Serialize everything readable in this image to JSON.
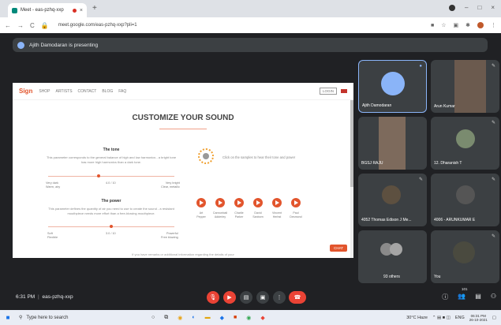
{
  "browser": {
    "tab_title": "Meet - eas-pzhq-xxp",
    "tab_close": "×",
    "new_tab": "+",
    "url": "meet.google.com/eas-pzhq-xxp?pli=1",
    "window_controls": [
      "–",
      "□",
      "×"
    ]
  },
  "presenting_banner": "Ajith Damodaran is presenting",
  "shared_site": {
    "logo": "Sign",
    "nav": [
      "SHOP",
      "ARTISTS",
      "CONTACT",
      "BLOG",
      "FAQ"
    ],
    "login": "LOGIN",
    "title": "CUSTOMIZE YOUR SOUND",
    "tone": {
      "title": "The tone",
      "text": "This parameter corresponds to the general balance of high and low harmonics - a bright tone has more high harmonics than a dark tone.",
      "left_label": "Very dark\nWarm, airy",
      "mid_label": "4.0 / 10",
      "right_label": "Very bright\nClear, metallic",
      "value": 0.4
    },
    "power": {
      "title": "The power",
      "text": "This parameter defines the quantity of air you need to use to create the sound - a resistant mouthpiece needs more effort than a free-blowing mouthpiece.",
      "left_label": "Soft\nFlexible",
      "mid_label": "3.0 / 10",
      "right_label": "Powerful\nFree blowing",
      "value": 0.5
    },
    "click_text": "Click on the samples to hear their tone and power",
    "samples": [
      {
        "label": "Art\nPepper"
      },
      {
        "label": "Cannonball\nAdderley"
      },
      {
        "label": "Charlie\nParker"
      },
      {
        "label": "David\nSanborn"
      },
      {
        "label": "Vincent\nHerbst"
      },
      {
        "label": "Paul\nDesmond"
      }
    ],
    "more_text": "If you have remarks or additional information regarding the details of your",
    "chat": "CHAT"
  },
  "participants": [
    {
      "name": "Ajith Damodaran",
      "type": "avatar",
      "color": "#8ab4f8"
    },
    {
      "name": "Arun Kumar",
      "type": "video"
    },
    {
      "name": "BGSJ RAJU",
      "type": "video"
    },
    {
      "name": "12. Dharanish T",
      "type": "photo"
    },
    {
      "name": "4052 Thomas Edison J Me...",
      "type": "photo"
    },
    {
      "name": "4006 - ARUNKUMAR E",
      "type": "photo"
    },
    {
      "name": "93 others",
      "type": "group"
    },
    {
      "name": "You",
      "type": "video"
    }
  ],
  "meeting": {
    "time": "6:31 PM",
    "separator": "|",
    "code": "eas-pzhq-xxp",
    "participant_count": "101"
  },
  "taskbar": {
    "search_placeholder": "Type here to search",
    "weather": "30°C Haze",
    "language": "ENG",
    "time": "06:31 PM",
    "date": "26-10-2021"
  }
}
